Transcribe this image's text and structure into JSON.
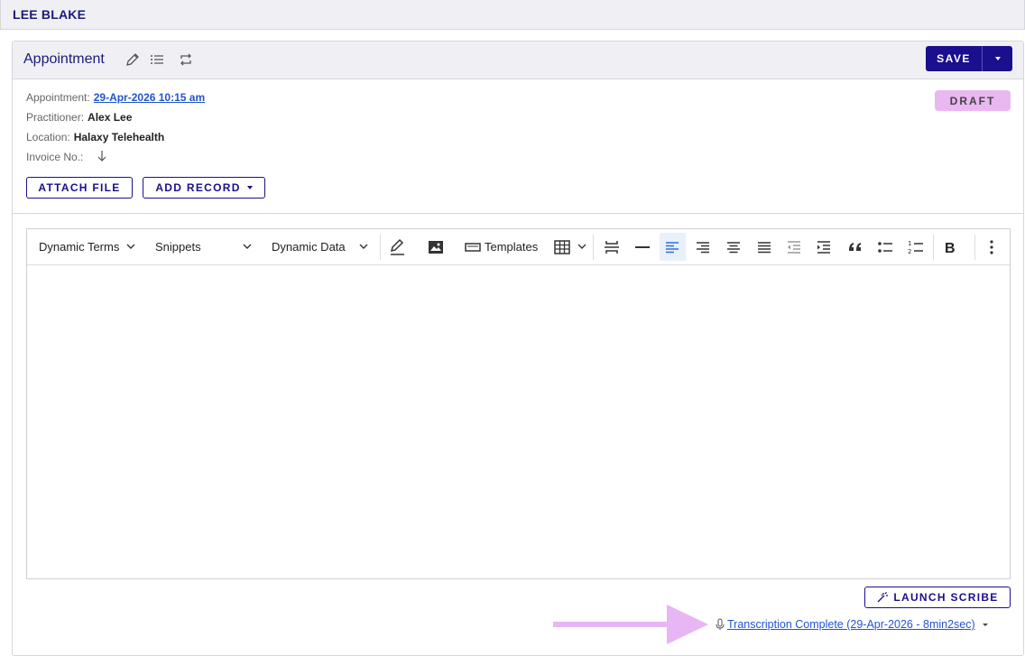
{
  "patient": {
    "name": "LEE BLAKE"
  },
  "appointment": {
    "title": "Appointment",
    "save_label": "SAVE",
    "status_badge": "DRAFT",
    "fields": {
      "appointment_label": "Appointment:",
      "appointment_value": "29-Apr-2026 10:15 am",
      "practitioner_label": "Practitioner:",
      "practitioner_value": "Alex Lee",
      "location_label": "Location:",
      "location_value": "Halaxy Telehealth",
      "invoice_label": "Invoice No.:"
    },
    "attach_file_label": "ATTACH FILE",
    "add_record_label": "ADD RECORD"
  },
  "editor": {
    "toolbar": {
      "dynamic_terms": "Dynamic Terms",
      "snippets": "Snippets",
      "dynamic_data": "Dynamic Data",
      "templates": "Templates",
      "active_alignment": "align-left"
    },
    "content": ""
  },
  "scribe": {
    "launch_label": "LAUNCH SCRIBE",
    "transcription_status": "Transcription Complete (29-Apr-2026 - 8min2sec)"
  },
  "colors": {
    "brand": "#1a0f8c",
    "draft_badge": "#e9b8f0",
    "link": "#2255cc",
    "annotation_arrow": "#e8b6f4"
  }
}
